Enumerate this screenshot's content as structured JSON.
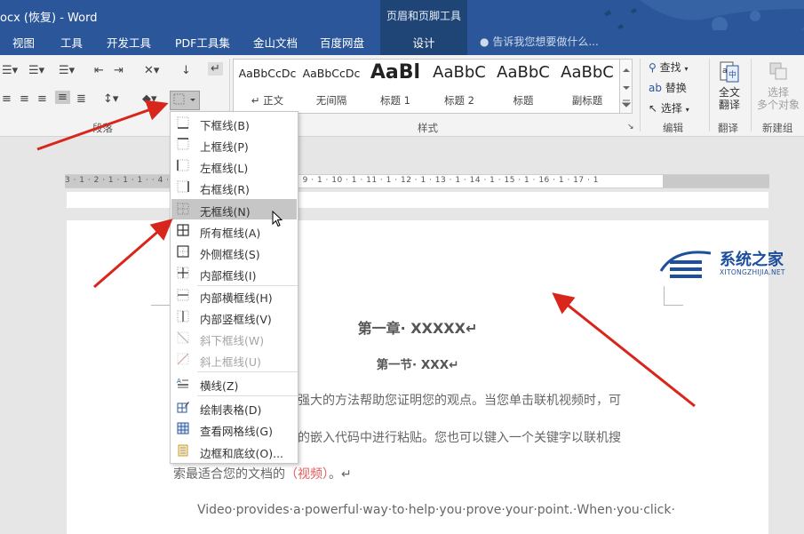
{
  "window": {
    "title": "ocx (恢复) - Word",
    "context_group": "页眉和页脚工具"
  },
  "tabs": [
    "视图",
    "工具",
    "开发工具",
    "PDF工具集",
    "金山文档",
    "百度网盘"
  ],
  "active_tab": "设计",
  "tell_me": "告诉我您想要做什么...",
  "ribbon": {
    "paragraph_group": "段落",
    "styles_group": "样式",
    "editing_group": "编辑",
    "translate_group": "翻译",
    "new_group": "新建组",
    "styles": [
      {
        "sample": "AaBbCcDc",
        "name": "↵ 正文"
      },
      {
        "sample": "AaBbCcDc",
        "name": "无间隔"
      },
      {
        "sample": "AaBl",
        "name": "标题 1"
      },
      {
        "sample": "AaBbC",
        "name": "标题 2"
      },
      {
        "sample": "AaBbC",
        "name": "标题"
      },
      {
        "sample": "AaBbC",
        "name": "副标题"
      }
    ],
    "find": "查找",
    "replace": "替换",
    "select": "选择",
    "full_translate_1": "全文",
    "full_translate_2": "翻译",
    "select_objects_1": "选择",
    "select_objects_2": "多个对象"
  },
  "ruler": {
    "labels": "3 · 1 · 2 · 1 · 1 · 1 ·            · 4 · 1 · 5 · 1 · 6 · 1 · 7 · 1 · 8 · 1 · 9 · 1 · 10 · 1 · 11 · 1 · 12 · 1 · 13 · 1 · 14 · 1 · 15 · 1 · 16 · 1 · 17 · 1"
  },
  "menu": {
    "items": [
      {
        "label": "下框线(B)",
        "icon": "bottom-border-icon"
      },
      {
        "label": "上框线(P)",
        "icon": "top-border-icon"
      },
      {
        "label": "左框线(L)",
        "icon": "left-border-icon"
      },
      {
        "label": "右框线(R)",
        "icon": "right-border-icon"
      },
      {
        "label": "无框线(N)",
        "icon": "no-border-icon"
      },
      {
        "label": "所有框线(A)",
        "icon": "all-borders-icon"
      },
      {
        "label": "外侧框线(S)",
        "icon": "outside-borders-icon"
      },
      {
        "label": "内部框线(I)",
        "icon": "inside-borders-icon"
      },
      {
        "label": "内部横框线(H)",
        "icon": "inside-horizontal-border-icon"
      },
      {
        "label": "内部竖框线(V)",
        "icon": "inside-vertical-border-icon"
      },
      {
        "label": "斜下框线(W)",
        "icon": "diagonal-down-border-icon"
      },
      {
        "label": "斜上框线(U)",
        "icon": "diagonal-up-border-icon"
      },
      {
        "label": "横线(Z)",
        "icon": "horizontal-line-icon"
      },
      {
        "label": "绘制表格(D)",
        "icon": "draw-table-icon"
      },
      {
        "label": "查看网格线(G)",
        "icon": "view-gridlines-icon"
      },
      {
        "label": "边框和底纹(O)...",
        "icon": "borders-shading-icon"
      }
    ]
  },
  "document": {
    "heading1": "第一章· XXXXX↵",
    "heading2": "第一节· XXX↵",
    "line1": "强大的方法帮助您证明您的观点。当您单击联机视频时，可",
    "line2": "的嵌入代码中进行粘贴。您也可以键入一个关键字以联机搜",
    "line3_before": "索最适合您的文档的",
    "line3_red": "（视频）",
    "line3_after": "。↵",
    "english": "Video·provides·a·powerful·way·to·help·you·prove·your·point.·When·you·click·"
  },
  "watermark": {
    "text": "系统之家",
    "sub": "XITONGZHIJIA.NET"
  }
}
